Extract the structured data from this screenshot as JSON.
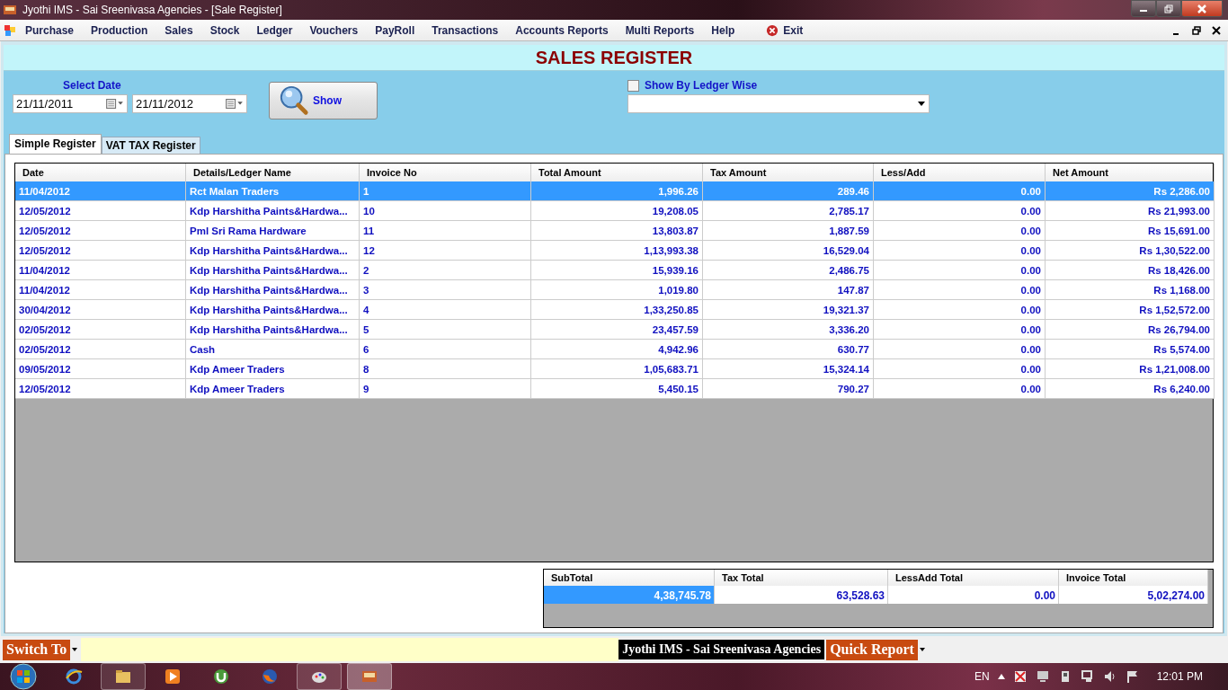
{
  "window": {
    "title": "Jyothi IMS - Sai Sreenivasa Agencies - [Sale Register]"
  },
  "menu": [
    "Purchase",
    "Production",
    "Sales",
    "Stock",
    "Ledger",
    "Vouchers",
    "PayRoll",
    "Transactions",
    "Accounts Reports",
    "Multi Reports",
    "Help"
  ],
  "exit_label": "Exit",
  "heading": "SALES REGISTER",
  "filters": {
    "date_label": "Select Date",
    "from_date": "21/11/2011",
    "to_date": "21/11/2012",
    "show_button": "Show",
    "ledger_wise": {
      "label": "Show By Ledger Wise",
      "checked": false
    }
  },
  "tabs": [
    {
      "label": "Simple Register",
      "selected": true
    },
    {
      "label": "VAT TAX Register",
      "selected": false
    }
  ],
  "table": {
    "columns": [
      "Date",
      "Details/Ledger Name",
      "Invoice No",
      "Total Amount",
      "Tax Amount",
      "Less/Add",
      "Net  Amount"
    ],
    "rows": [
      {
        "selected": true,
        "cells": [
          "11/04/2012",
          "Rct Malan Traders",
          "1",
          "1,996.26",
          "289.46",
          "0.00",
          "Rs 2,286.00"
        ]
      },
      {
        "selected": false,
        "cells": [
          "12/05/2012",
          "Kdp Harshitha Paints&Hardwa...",
          "10",
          "19,208.05",
          "2,785.17",
          "0.00",
          "Rs 21,993.00"
        ]
      },
      {
        "selected": false,
        "cells": [
          "12/05/2012",
          "Pml Sri Rama Hardware",
          "11",
          "13,803.87",
          "1,887.59",
          "0.00",
          "Rs 15,691.00"
        ]
      },
      {
        "selected": false,
        "cells": [
          "12/05/2012",
          "Kdp Harshitha Paints&Hardwa...",
          "12",
          "1,13,993.38",
          "16,529.04",
          "0.00",
          "Rs 1,30,522.00"
        ]
      },
      {
        "selected": false,
        "cells": [
          "11/04/2012",
          "Kdp Harshitha Paints&Hardwa...",
          "2",
          "15,939.16",
          "2,486.75",
          "0.00",
          "Rs 18,426.00"
        ]
      },
      {
        "selected": false,
        "cells": [
          "11/04/2012",
          "Kdp Harshitha Paints&Hardwa...",
          "3",
          "1,019.80",
          "147.87",
          "0.00",
          "Rs 1,168.00"
        ]
      },
      {
        "selected": false,
        "cells": [
          "30/04/2012",
          "Kdp Harshitha Paints&Hardwa...",
          "4",
          "1,33,250.85",
          "19,321.37",
          "0.00",
          "Rs 1,52,572.00"
        ]
      },
      {
        "selected": false,
        "cells": [
          "02/05/2012",
          "Kdp Harshitha Paints&Hardwa...",
          "5",
          "23,457.59",
          "3,336.20",
          "0.00",
          "Rs 26,794.00"
        ]
      },
      {
        "selected": false,
        "cells": [
          "02/05/2012",
          "Cash",
          "6",
          "4,942.96",
          "630.77",
          "0.00",
          "Rs 5,574.00"
        ]
      },
      {
        "selected": false,
        "cells": [
          "09/05/2012",
          "Kdp Ameer Traders",
          "8",
          "1,05,683.71",
          "15,324.14",
          "0.00",
          "Rs 1,21,008.00"
        ]
      },
      {
        "selected": false,
        "cells": [
          "12/05/2012",
          "Kdp Ameer Traders",
          "9",
          "5,450.15",
          "790.27",
          "0.00",
          "Rs 6,240.00"
        ]
      }
    ]
  },
  "totals": {
    "columns": [
      "SubTotal",
      "Tax Total",
      "LessAdd Total",
      "Invoice Total"
    ],
    "cells": [
      {
        "value": "4,38,745.78",
        "selected": true
      },
      {
        "value": "63,528.63",
        "selected": false
      },
      {
        "value": "0.00",
        "selected": false
      },
      {
        "value": "5,02,274.00",
        "selected": false
      }
    ]
  },
  "bottom_bar": {
    "switch_to": "Switch To",
    "company": "Jyothi IMS - Sai Sreenivasa Agencies",
    "quick_report": "Quick Report"
  },
  "taskbar": {
    "language": "EN",
    "clock": "12:01 PM"
  }
}
